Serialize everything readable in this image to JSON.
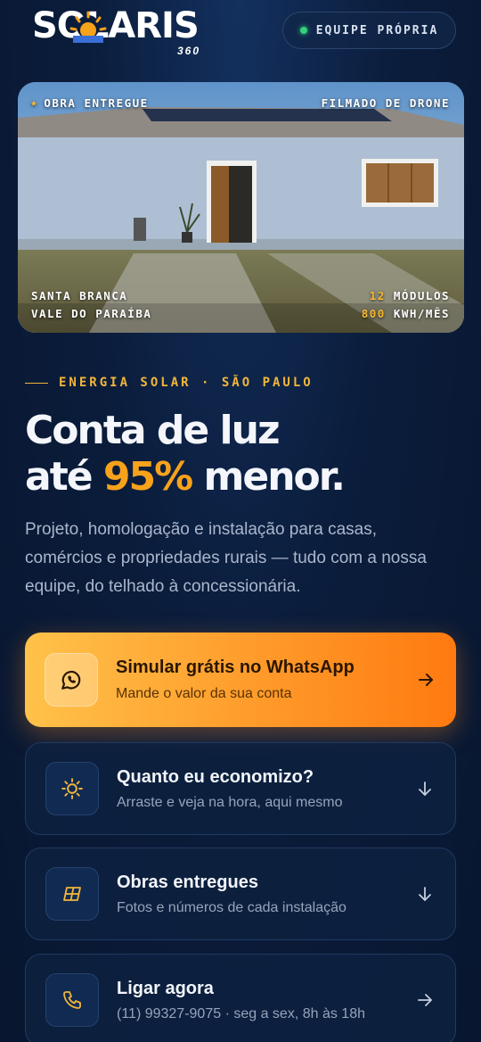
{
  "brand": {
    "logo_main": "SOLARIS",
    "logo_sub": "360",
    "badge_label": "EQUIPE PRÓPRIA"
  },
  "hero_photo": {
    "top_left": "OBRA ENTREGUE",
    "top_right": "FILMADO DE DRONE",
    "city": "SANTA BRANCA",
    "region": "VALE DO PARAÍBA",
    "modules_value": "12",
    "modules_label": "MÓDULOS",
    "energy_value": "800",
    "energy_label": "KWH/MÊS"
  },
  "eyebrow": "ENERGIA SOLAR · SÃO PAULO",
  "headline": {
    "line1": "Conta de luz",
    "line2_pre": "até ",
    "line2_highlight": "95%",
    "line2_post": " menor."
  },
  "description": "Projeto, homologação e instalação para casas, comércios e propriedades rurais — tudo com a nossa equipe, do telhado à concessionária.",
  "actions": [
    {
      "title": "Simular grátis no WhatsApp",
      "subtitle": "Mande o valor da sua conta",
      "icon": "whatsapp-icon",
      "arrow": "arrow-right-icon"
    },
    {
      "title": "Quanto eu economizo?",
      "subtitle": "Arraste e veja na hora, aqui mesmo",
      "icon": "sun-icon",
      "arrow": "arrow-down-icon"
    },
    {
      "title": "Obras entregues",
      "subtitle": "Fotos e números de cada instalação",
      "icon": "solar-panel-icon",
      "arrow": "arrow-down-icon"
    },
    {
      "title": "Ligar agora",
      "subtitle": "(11) 99327-9075 · seg a sex, 8h às 18h",
      "icon": "phone-icon",
      "arrow": "arrow-right-icon"
    }
  ],
  "colors": {
    "accent": "#f7a21b",
    "background": "#0b1d3c",
    "online": "#33d17a"
  }
}
